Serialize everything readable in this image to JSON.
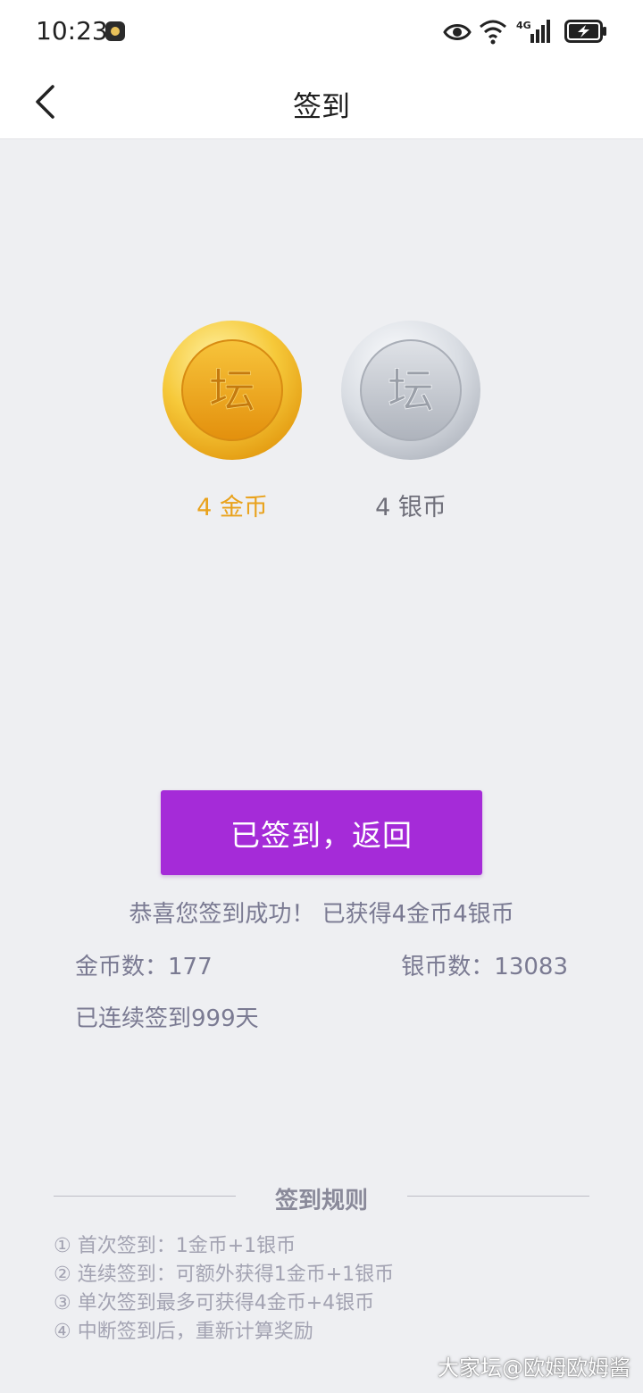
{
  "status_bar": {
    "time": "10:23",
    "network_label": "4G"
  },
  "header": {
    "title": "签到",
    "back_icon": "chevron-left-icon"
  },
  "rewards": {
    "coin_glyph": "坛",
    "gold_label": "4 金币",
    "silver_label": "4 银币",
    "gold_color": "#e9a21c",
    "silver_color": "#6f6f7a"
  },
  "main": {
    "button_label": "已签到，返回",
    "button_color": "#a52bd8",
    "success_message": "恭喜您签到成功！ 已获得4金币4银币",
    "gold_total": "金币数：177",
    "silver_total": "银币数：13083",
    "streak": "已连续签到999天"
  },
  "rules": {
    "title": "签到规则",
    "items": [
      "① 首次签到：1金币+1银币",
      "② 连续签到：可额外获得1金币+1银币",
      "③ 单次签到最多可获得4金币+4银币",
      "④ 中断签到后，重新计算奖励"
    ]
  },
  "watermark": "大家坛@欧姆欧姆酱"
}
